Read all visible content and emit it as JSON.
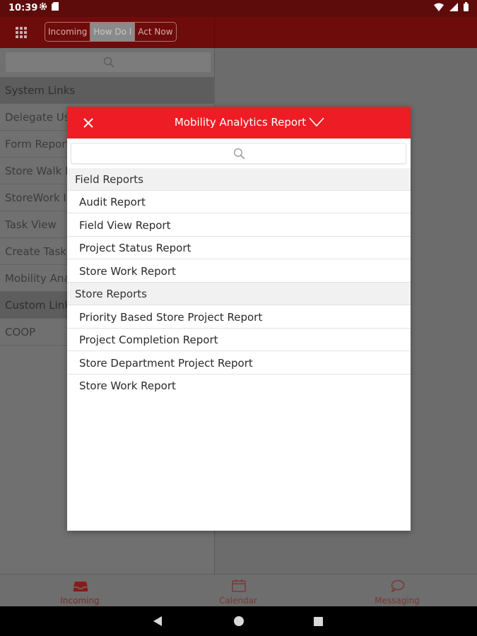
{
  "status_bar": {
    "time": "10:39",
    "left_icons": [
      "gear-icon",
      "sd-card-icon"
    ],
    "right_icons": [
      "wifi-icon",
      "signal-icon",
      "battery-icon"
    ]
  },
  "header": {
    "tabs": [
      {
        "label": "Incoming"
      },
      {
        "label": "How Do I"
      },
      {
        "label": "Act Now"
      }
    ],
    "active_tab": "How Do I"
  },
  "left_list": [
    {
      "label": "System Links",
      "type": "section"
    },
    {
      "label": "Delegate Users",
      "type": "item"
    },
    {
      "label": "Form Reports",
      "type": "item"
    },
    {
      "label": "Store Walk Reports",
      "type": "item"
    },
    {
      "label": "StoreWork Insights",
      "type": "item"
    },
    {
      "label": "Task View",
      "type": "item"
    },
    {
      "label": "Create Task",
      "type": "item"
    },
    {
      "label": "Mobility Analytics Report",
      "type": "item"
    },
    {
      "label": "Custom Links",
      "type": "section"
    },
    {
      "label": "COOP",
      "type": "item"
    }
  ],
  "dialog": {
    "title": "Mobility Analytics Report",
    "search_placeholder": "",
    "rows": [
      {
        "label": "Field Reports",
        "type": "group"
      },
      {
        "label": "Audit Report",
        "type": "item"
      },
      {
        "label": "Field View Report",
        "type": "item"
      },
      {
        "label": "Project Status Report",
        "type": "item"
      },
      {
        "label": "Store Work Report",
        "type": "item"
      },
      {
        "label": "Store Reports",
        "type": "group"
      },
      {
        "label": "Priority Based Store Project Report",
        "type": "item"
      },
      {
        "label": "Project Completion Report",
        "type": "item"
      },
      {
        "label": "Store Department Project Report",
        "type": "item"
      },
      {
        "label": "Store Work Report",
        "type": "item"
      }
    ]
  },
  "bottom_nav": [
    {
      "label": "Incoming",
      "icon": "inbox-icon",
      "active": true
    },
    {
      "label": "Calendar",
      "icon": "calendar-icon",
      "active": false
    },
    {
      "label": "Messaging",
      "icon": "chat-bubble-icon",
      "active": false
    }
  ],
  "colors": {
    "brand_red": "#ee1c24",
    "header_dark_red": "#6e0b0b",
    "overlay_gray": "#6c6c6c"
  }
}
